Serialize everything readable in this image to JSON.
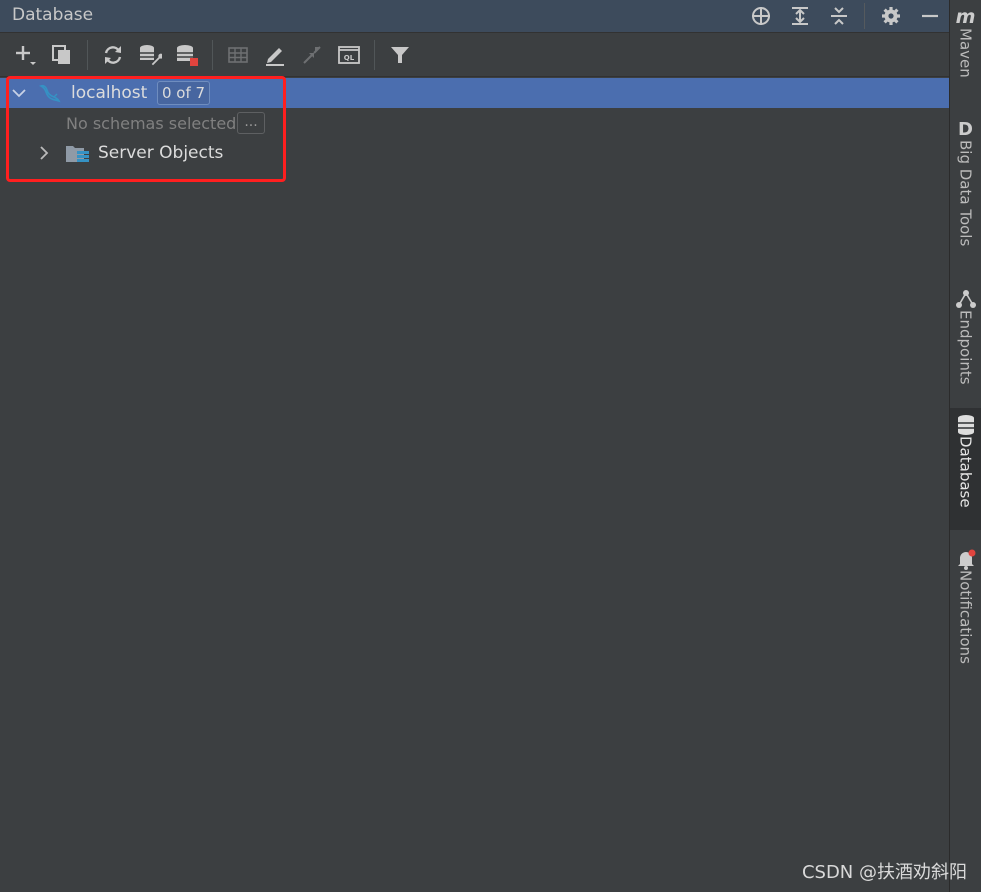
{
  "panel": {
    "title": "Database"
  },
  "toolbar": {
    "tools": [
      "add-icon",
      "duplicate-icon",
      "refresh-icon",
      "data-source-properties-icon",
      "stop-icon",
      "table-view-icon",
      "edit-icon",
      "jump-to-source-icon",
      "query-console-icon",
      "filter-icon"
    ],
    "ql_text": "QL"
  },
  "tree": {
    "root": {
      "label": "localhost",
      "badge": "0 of 7",
      "expanded": true
    },
    "no_schemas": "No schemas selected",
    "ellipsis": "...",
    "server_objects": {
      "label": "Server Objects",
      "expanded": false
    }
  },
  "stripe": {
    "maven_glyph": "m",
    "maven": "Maven",
    "bigdata_glyph": "D",
    "bigdata": "Big Data Tools",
    "endpoints": "Endpoints",
    "database": "Database",
    "notifications": "Notifications",
    "active": "Database"
  },
  "watermark": "CSDN @扶酒劝斜阳",
  "colors": {
    "panel_bg": "#3c3f41",
    "title_bg": "#3d4b5c",
    "selection": "#4b6eaf",
    "highlight": "#ff1f1f",
    "mysql_blue": "#3592c4",
    "stop_red": "#e0443e"
  }
}
